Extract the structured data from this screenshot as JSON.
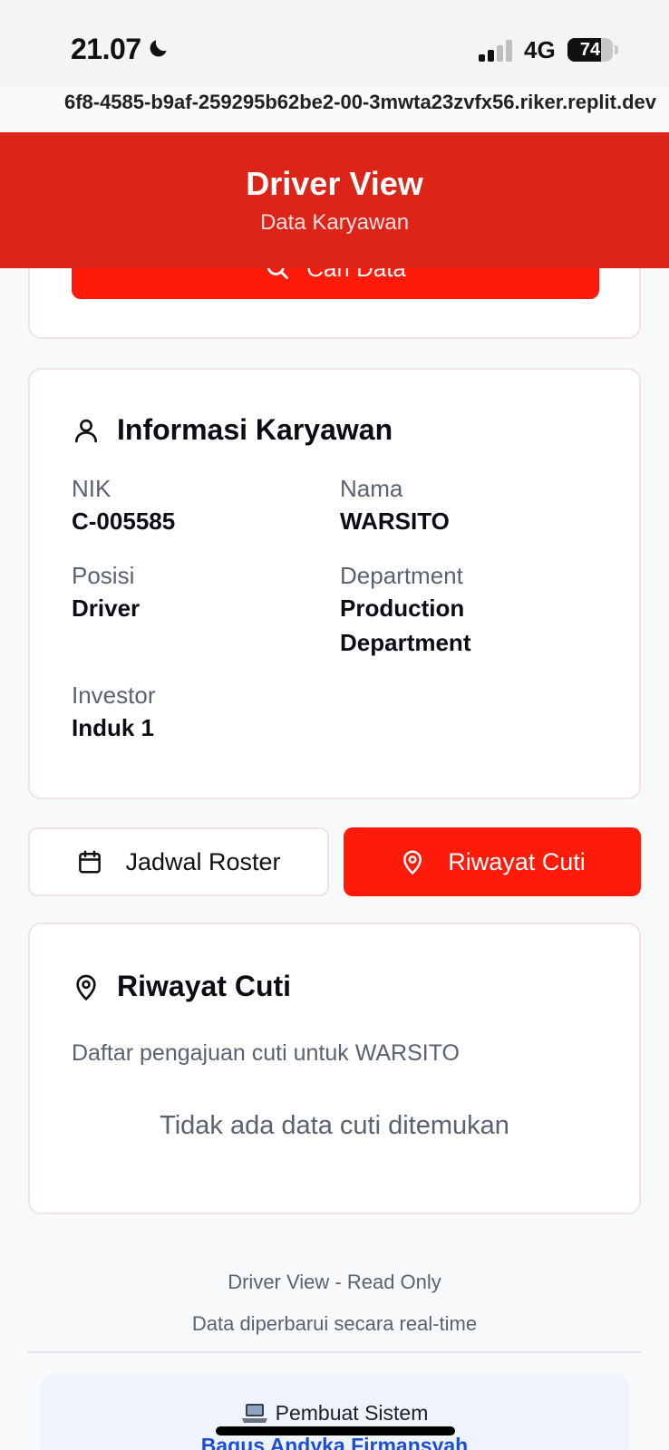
{
  "status_bar": {
    "time": "21.07",
    "network": "4G",
    "battery_percent": 74,
    "battery_label": "74"
  },
  "browser": {
    "url": "6f8-4585-b9af-259295b62be2-00-3mwta23zvfx56.riker.replit.dev"
  },
  "header": {
    "title": "Driver View",
    "subtitle": "Data Karyawan"
  },
  "search": {
    "button_label": "Cari Data"
  },
  "employee": {
    "heading": "Informasi Karyawan",
    "fields": {
      "nik": {
        "label": "NIK",
        "value": "C-005585"
      },
      "nama": {
        "label": "Nama",
        "value": "WARSITO"
      },
      "posisi": {
        "label": "Posisi",
        "value": "Driver"
      },
      "department": {
        "label": "Department",
        "value_line1": "Production",
        "value_line2": "Department"
      },
      "investor": {
        "label": "Investor",
        "value": "Induk 1"
      }
    }
  },
  "tabs": {
    "roster_label": "Jadwal Roster",
    "cuti_label": "Riwayat Cuti",
    "active": "cuti"
  },
  "leave": {
    "heading": "Riwayat Cuti",
    "description": "Daftar pengajuan cuti untuk WARSITO",
    "empty_message": "Tidak ada data cuti ditemukan"
  },
  "footer": {
    "line1": "Driver View - Read Only",
    "line2": "Data diperbarui secara real-time",
    "creator_label": "Pembuat Sistem",
    "creator_name": "Bagus Andyka Firmansyah"
  },
  "colors": {
    "header_red": "#dd2418",
    "accent_red": "#ff1a0a",
    "link_blue": "#1d4ed8"
  },
  "icons": {
    "moon": "moon-icon",
    "signal": "cellular-signal-icon",
    "search": "search-icon",
    "user": "user-icon",
    "calendar": "calendar-icon",
    "pin": "map-pin-icon",
    "laptop": "laptop-icon"
  }
}
